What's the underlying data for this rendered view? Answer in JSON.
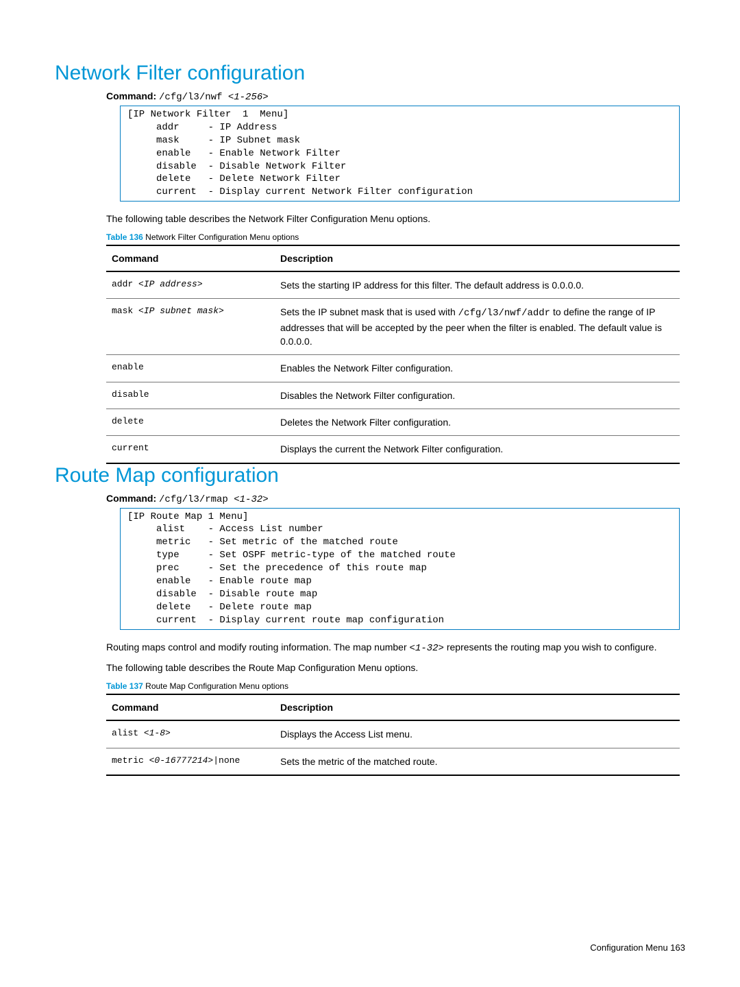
{
  "section1": {
    "heading": "Network Filter configuration",
    "cmd_label": "Command:",
    "cmd_path": " /cfg/l3/nwf ",
    "cmd_arg": "<1-256>",
    "terminal": "[IP Network Filter  1  Menu]\n     addr     - IP Address\n     mask     - IP Subnet mask\n     enable   - Enable Network Filter\n     disable  - Disable Network Filter\n     delete   - Delete Network Filter\n     current  - Display current Network Filter configuration",
    "intro": "The following table describes the Network Filter Configuration Menu options.",
    "table_caption_label": "Table 136",
    "table_caption_text": "  Network Filter Configuration Menu options",
    "th_cmd": "Command",
    "th_desc": "Description",
    "rows": [
      {
        "cmd": "addr ",
        "arg": "<IP address>",
        "desc": "Sets the starting IP address for this filter. The default address is 0.0.0.0."
      },
      {
        "cmd": "mask ",
        "arg": "<IP subnet mask>",
        "desc_pre": "Sets the IP subnet mask that is used with ",
        "desc_mono": "/cfg/l3/nwf/addr",
        "desc_post": " to define the range of IP addresses that will be accepted by the peer when the filter is enabled. The default value is 0.0.0.0."
      },
      {
        "cmd": "enable",
        "arg": "",
        "desc": "Enables the Network Filter configuration."
      },
      {
        "cmd": "disable",
        "arg": "",
        "desc": "Disables the Network Filter configuration."
      },
      {
        "cmd": "delete",
        "arg": "",
        "desc": "Deletes the Network Filter configuration."
      },
      {
        "cmd": "current",
        "arg": "",
        "desc": "Displays the current the Network Filter configuration."
      }
    ]
  },
  "section2": {
    "heading": "Route Map configuration",
    "cmd_label": "Command:",
    "cmd_path": " /cfg/l3/rmap ",
    "cmd_arg": "<1-32>",
    "terminal": "[IP Route Map 1 Menu]\n     alist    - Access List number\n     metric   - Set metric of the matched route\n     type     - Set OSPF metric-type of the matched route\n     prec     - Set the precedence of this route map\n     enable   - Enable route map\n     disable  - Disable route map\n     delete   - Delete route map\n     current  - Display current route map configuration",
    "intro1_pre": "Routing maps control and modify routing information. The map number ",
    "intro1_mono": "<1-32>",
    "intro1_post": " represents the routing map you wish to configure.",
    "intro2": "The following table describes the Route Map Configuration Menu options.",
    "table_caption_label": "Table 137",
    "table_caption_text": "  Route Map Configuration Menu options",
    "th_cmd": "Command",
    "th_desc": "Description",
    "rows": [
      {
        "cmd": "alist ",
        "arg": "<1-8>",
        "desc": "Displays the Access List menu."
      },
      {
        "cmd": "metric ",
        "arg": "<0-16777214>",
        "cmd_post": "|none",
        "desc": "Sets the metric of the matched route."
      }
    ]
  },
  "footer": {
    "text": "Configuration Menu   163"
  }
}
